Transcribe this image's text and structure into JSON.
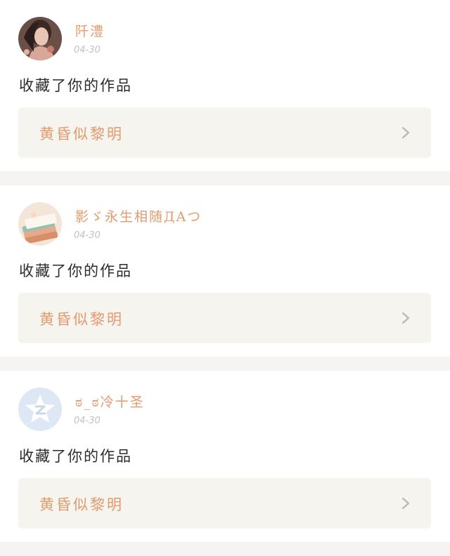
{
  "colors": {
    "accent": "#e39a6c",
    "text": "#2b2b2b",
    "muted": "#c2c2c2",
    "panel": "#f5f4ee",
    "separator": "#f6f4f3"
  },
  "feed": {
    "items": [
      {
        "username": "阡澧",
        "date": "04-30",
        "action": "收藏了你的作品",
        "work_title": "黄昏似黎明",
        "avatar_icon": "avatar-photo-icon"
      },
      {
        "username": "影ゞ永生相随ДAつ",
        "date": "04-30",
        "action": "收藏了你的作品",
        "work_title": "黄昏似黎明",
        "avatar_icon": "book-avatar-icon"
      },
      {
        "username": "ಠ_ಠ冷十圣",
        "date": "04-30",
        "action": "收藏了你的作品",
        "work_title": "黄昏似黎明",
        "avatar_icon": "default-star-avatar-icon"
      }
    ]
  }
}
